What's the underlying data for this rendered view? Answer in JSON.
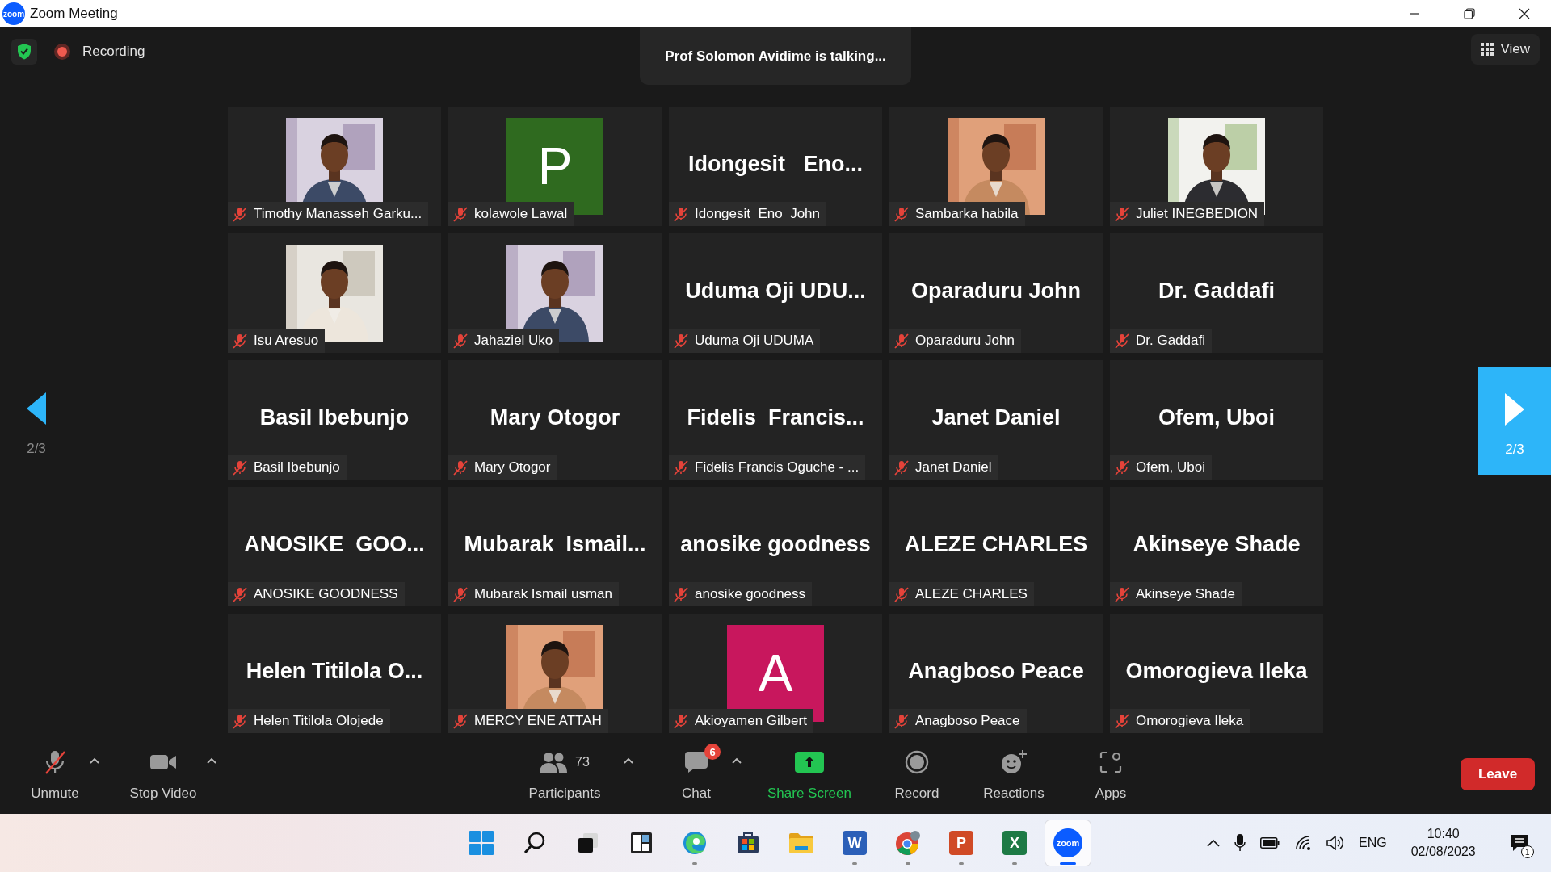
{
  "window": {
    "title": "Zoom Meeting",
    "logo": "zoom"
  },
  "top_bar": {
    "recording": "Recording",
    "talking": "Prof Solomon Avidime is talking...",
    "view": "View"
  },
  "pager": {
    "previous": "2/3",
    "next": "2/3"
  },
  "tiles": [
    {
      "label": "Timothy Manasseh Garku...",
      "muted": true
    },
    {
      "kind": "avatar",
      "letter": "P",
      "color": "#2f6a1f",
      "label": "kolawole Lawal",
      "muted": true
    },
    {
      "kind": "name",
      "display": "Idongesit   Eno...",
      "label": "Idongesit  Eno  John",
      "muted": true
    },
    {
      "label": "Sambarka habila",
      "muted": true
    },
    {
      "label": "Juliet INEGBEDION",
      "muted": true
    },
    {
      "label": "Isu Aresuo",
      "muted": true
    },
    {
      "label": "Jahaziel Uko",
      "muted": true
    },
    {
      "kind": "name",
      "display": "Uduma Oji UDU...",
      "label": "Uduma Oji UDUMA",
      "muted": true
    },
    {
      "kind": "name",
      "display": "Oparaduru John",
      "label": "Oparaduru John",
      "muted": true
    },
    {
      "kind": "name",
      "display": "Dr. Gaddafi",
      "label": "Dr. Gaddafi",
      "muted": true
    },
    {
      "kind": "name",
      "display": "Basil Ibebunjo",
      "label": "Basil Ibebunjo",
      "muted": true
    },
    {
      "kind": "name",
      "display": "Mary Otogor",
      "label": "Mary Otogor",
      "muted": true
    },
    {
      "kind": "name",
      "display": "Fidelis  Francis...",
      "label": "Fidelis Francis Oguche - ...",
      "muted": true
    },
    {
      "kind": "name",
      "display": "Janet Daniel",
      "label": "Janet Daniel",
      "muted": true
    },
    {
      "kind": "name",
      "display": "Ofem, Uboi",
      "label": "Ofem, Uboi",
      "muted": true
    },
    {
      "kind": "name",
      "display": "ANOSIKE  GOO...",
      "label": "ANOSIKE GOODNESS",
      "muted": true
    },
    {
      "kind": "name",
      "display": "Mubarak  Ismail...",
      "label": "Mubarak Ismail usman",
      "muted": true
    },
    {
      "kind": "name",
      "display": "anosike goodness",
      "label": "anosike goodness",
      "muted": true
    },
    {
      "kind": "name",
      "display": "ALEZE CHARLES",
      "label": "ALEZE CHARLES",
      "muted": true
    },
    {
      "kind": "name",
      "display": "Akinseye Shade",
      "label": "Akinseye Shade",
      "muted": true
    },
    {
      "kind": "name",
      "display": "Helen Titilola O...",
      "label": "Helen Titilola Olojede",
      "muted": true
    },
    {
      "label": "MERCY ENE ATTAH",
      "muted": true
    },
    {
      "kind": "avatar",
      "letter": "A",
      "color": "#c8175d",
      "label": "Akioyamen Gilbert",
      "muted": true
    },
    {
      "kind": "name",
      "display": "Anagboso Peace",
      "label": "Anagboso Peace",
      "muted": true
    },
    {
      "kind": "name",
      "display": "Omorogieva Ileka",
      "label": "Omorogieva Ileka",
      "muted": true
    }
  ],
  "toolbar": {
    "items": [
      {
        "kind": "mic",
        "label": "Unmute",
        "muted": true,
        "menu": true
      },
      {
        "kind": "video",
        "label": "Stop Video",
        "menu": true
      },
      {
        "kind": "participants",
        "label": "Participants",
        "count": "73",
        "menu": true
      },
      {
        "kind": "chat",
        "label": "Chat",
        "badge": "6",
        "menu": true
      },
      {
        "kind": "share",
        "label": "Share Screen",
        "menu": false
      },
      {
        "kind": "record",
        "label": "Record",
        "menu": false
      },
      {
        "kind": "reactions",
        "label": "Reactions",
        "menu": false
      },
      {
        "kind": "apps",
        "label": "Apps",
        "menu": false
      }
    ],
    "leave": "Leave"
  },
  "taskbar": {
    "apps": [
      {
        "kind": "start",
        "running": false,
        "active": false
      },
      {
        "kind": "search",
        "running": false,
        "active": false
      },
      {
        "kind": "taskview",
        "running": false,
        "active": false
      },
      {
        "kind": "widgets",
        "running": false,
        "active": false
      },
      {
        "kind": "edge",
        "running": true,
        "active": false
      },
      {
        "kind": "store",
        "running": false,
        "active": false
      },
      {
        "kind": "folder",
        "running": false,
        "active": false
      },
      {
        "kind": "letter",
        "letter": "W",
        "color": "#2b5fb8",
        "running": true,
        "active": false
      },
      {
        "kind": "chrome",
        "running": true,
        "active": false
      },
      {
        "kind": "letter",
        "letter": "P",
        "color": "#d04a26",
        "running": true,
        "active": false
      },
      {
        "kind": "letter",
        "letter": "X",
        "color": "#1d7a45",
        "running": true,
        "active": false
      },
      {
        "kind": "zoom",
        "letter": "zoom",
        "running": true,
        "active": true
      }
    ],
    "tray": {
      "language": "ENG",
      "time": "10:40",
      "date": "02/08/2023",
      "notifications": "1"
    }
  }
}
